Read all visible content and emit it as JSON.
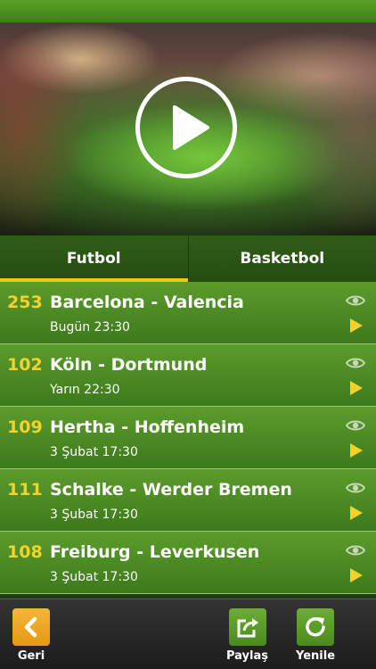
{
  "hero": {
    "play_icon": "play-icon"
  },
  "tabs": [
    {
      "label": "Futbol",
      "active": true
    },
    {
      "label": "Basketbol",
      "active": false
    }
  ],
  "matches": [
    {
      "viewers": "253",
      "title": "Barcelona - Valencia",
      "time": "Bugün 23:30"
    },
    {
      "viewers": "102",
      "title": "Köln - Dortmund",
      "time": "Yarın 22:30"
    },
    {
      "viewers": "109",
      "title": "Hertha - Hoffenheim",
      "time": "3 Şubat 17:30"
    },
    {
      "viewers": "111",
      "title": "Schalke - Werder Bremen",
      "time": "3 Şubat 17:30"
    },
    {
      "viewers": "108",
      "title": "Freiburg - Leverkusen",
      "time": "3 Şubat 17:30"
    }
  ],
  "toolbar": {
    "back_label": "Geri",
    "share_label": "Paylaş",
    "refresh_label": "Yenile"
  },
  "colors": {
    "accent": "#f0c41e",
    "viewer_count": "#f3d22a",
    "row_green": "#4d8c25",
    "back_orange": "#f0a82a"
  }
}
